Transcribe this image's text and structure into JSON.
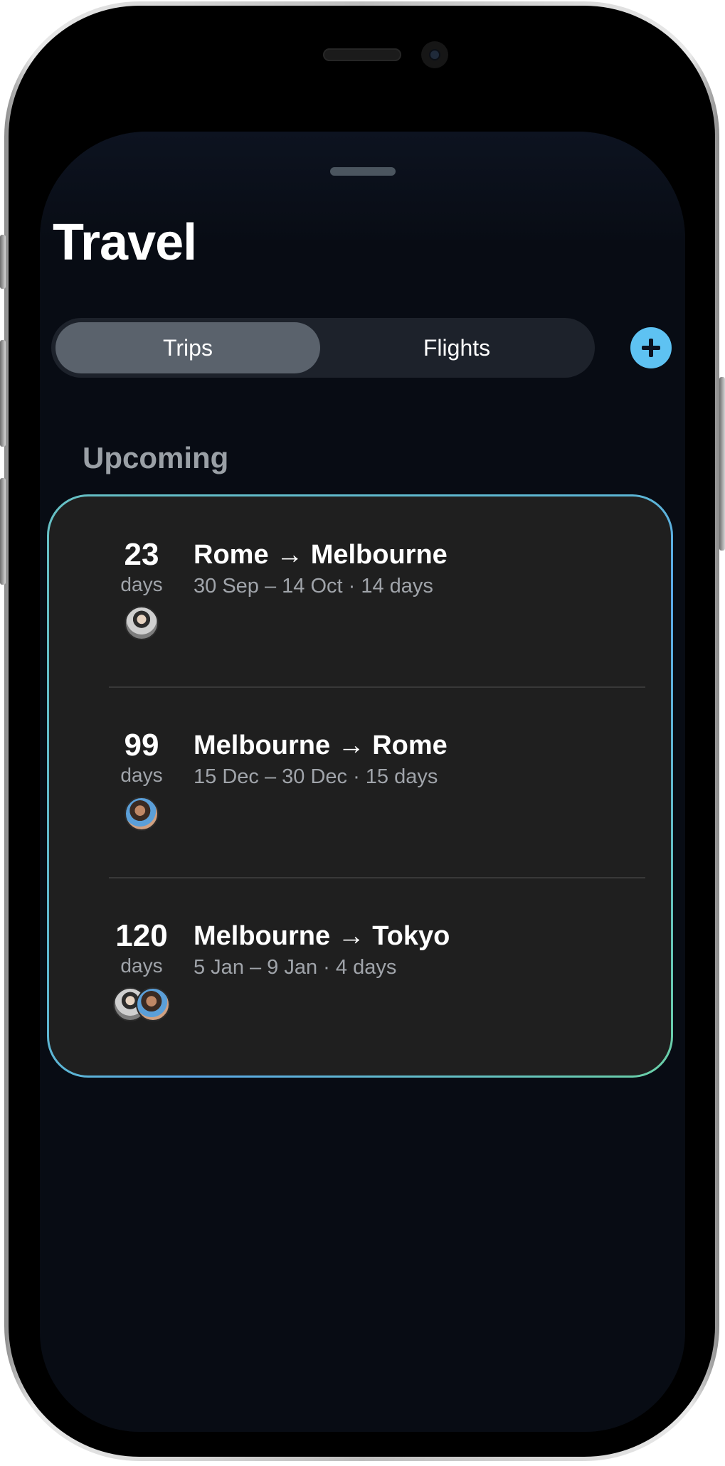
{
  "app": {
    "title": "Travel"
  },
  "segments": {
    "trips_label": "Trips",
    "flights_label": "Flights",
    "selected": "Trips"
  },
  "add_button": {
    "icon": "plus-icon",
    "color": "#5ec2f2"
  },
  "section": {
    "header": "Upcoming"
  },
  "trips": [
    {
      "count": "23",
      "unit": "days",
      "route": "Rome → Melbourne",
      "details": "30 Sep – 14 Oct · 14 days",
      "avatars": [
        "avatar-man"
      ]
    },
    {
      "count": "99",
      "unit": "days",
      "route": "Melbourne → Rome",
      "details": "15 Dec – 30 Dec · 15 days",
      "avatars": [
        "avatar-woman"
      ]
    },
    {
      "count": "120",
      "unit": "days",
      "route": "Melbourne → Tokyo",
      "details": "5 Jan – 9 Jan · 4 days",
      "avatars": [
        "avatar-man",
        "avatar-woman"
      ]
    }
  ],
  "colors": {
    "background": "#080c14",
    "card": "#1f1f1f",
    "accent": "#5ec2f2",
    "card_border_start": "#66c0c4",
    "card_border_end": "#6ad0a6"
  }
}
